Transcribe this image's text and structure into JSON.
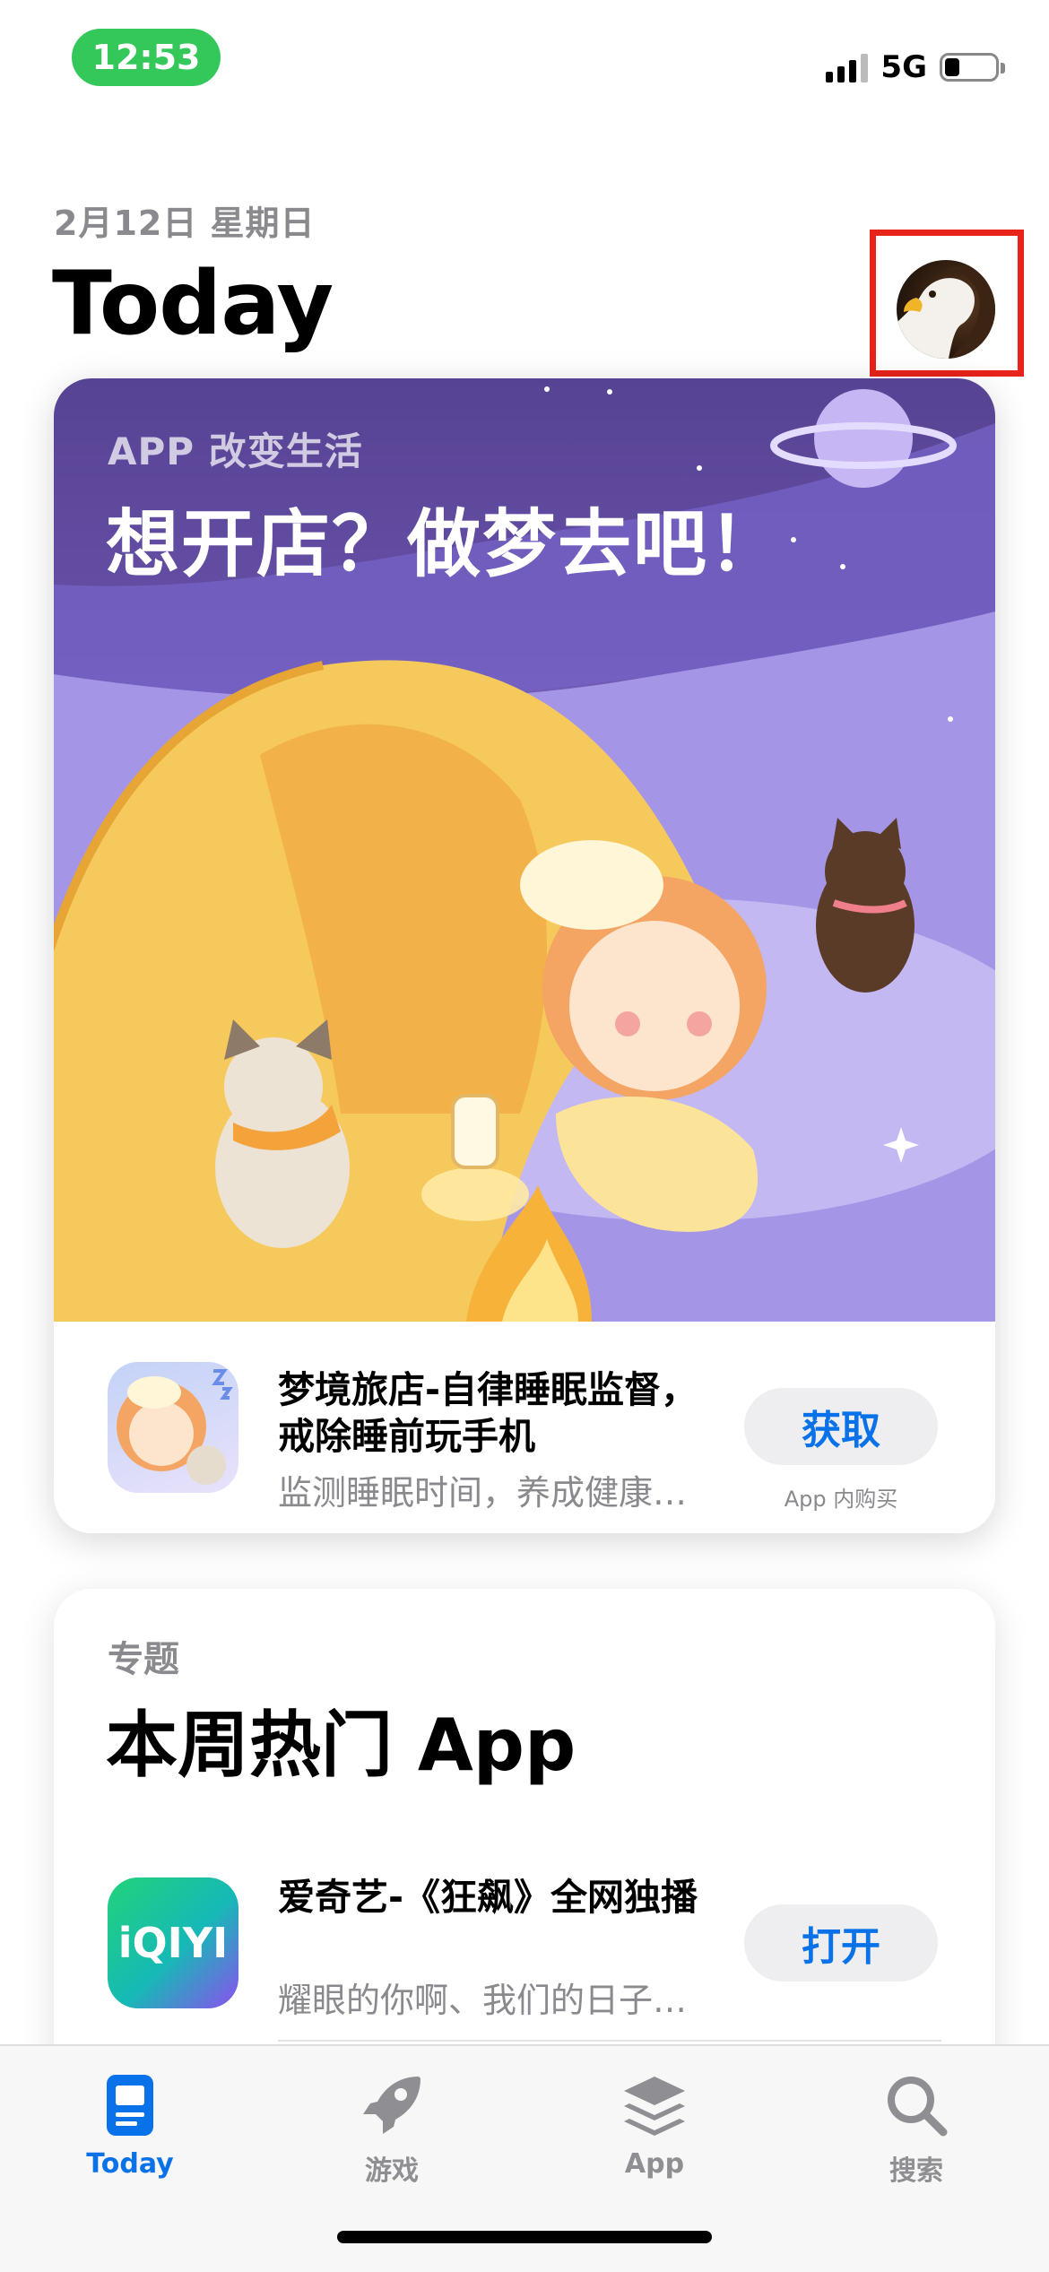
{
  "status_bar": {
    "time": "12:53",
    "network": "5G",
    "battery_level": 0.3
  },
  "header": {
    "date": "2月12日 星期日",
    "title": "Today"
  },
  "feature_card": {
    "eyebrow": "APP 改变生活",
    "title": "想开店？做梦去吧！",
    "app": {
      "name": "梦境旅店-自律睡眠监督，戒除睡前玩手机",
      "subtitle": "监测睡眠时间，养成健康…",
      "button": "获取",
      "iap_note": "App 内购买"
    }
  },
  "collection_card": {
    "eyebrow": "专题",
    "title": "本周热门 App",
    "apps": [
      {
        "name": "爱奇艺-《狂飙》全网独播",
        "subtitle": "耀眼的你啊、我们的日子…",
        "button": "打开",
        "icon_text": "iQIYI"
      }
    ]
  },
  "tab_bar": {
    "tabs": [
      {
        "label": "Today",
        "icon": "today-icon",
        "active": true
      },
      {
        "label": "游戏",
        "icon": "rocket-icon",
        "active": false
      },
      {
        "label": "App",
        "icon": "stack-icon",
        "active": false
      },
      {
        "label": "搜索",
        "icon": "search-icon",
        "active": false
      }
    ]
  },
  "colors": {
    "accent": "#0a72e8",
    "status_pill": "#34c759",
    "highlight_box": "#e8231a"
  }
}
